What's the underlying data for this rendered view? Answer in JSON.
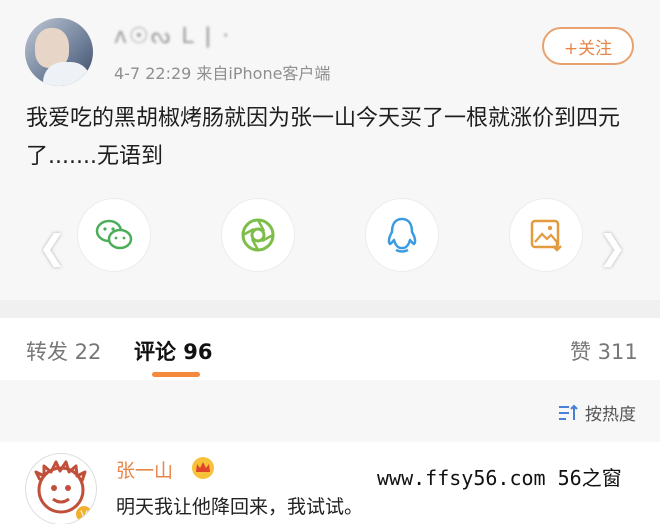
{
  "post": {
    "username": "ᴧ☉ᔓ ᒪ ǀ ·",
    "meta": "4-7 22:29 来自iPhone客户端",
    "follow_label": "+关注",
    "content": "我爱吃的黑胡椒烤肠就因为张一山今天买了一根就涨价到四元了.......无语到"
  },
  "share": {
    "items": [
      "wechat-icon",
      "moments-icon",
      "qq-icon",
      "save-image-icon"
    ]
  },
  "tabs": {
    "repost": "转发 22",
    "comments": "评论 96",
    "likes": "赞 311"
  },
  "sort": {
    "label": "按热度"
  },
  "comment": {
    "name": "张一山",
    "text": "明天我让他降回来，我试试。"
  },
  "watermark": "www.ffsy56.com 56之窗",
  "colors": {
    "accent": "#e8864a",
    "underline": "#f58a3c"
  }
}
